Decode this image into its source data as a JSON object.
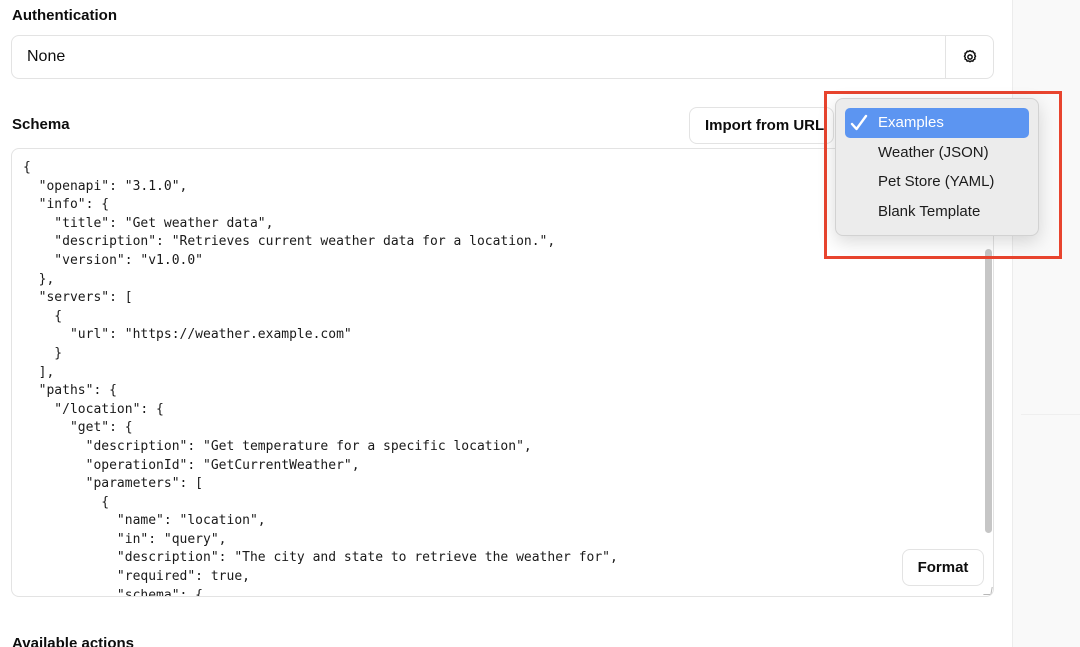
{
  "authentication": {
    "label": "Authentication",
    "value": "None",
    "settings_icon": "gear-icon"
  },
  "schema": {
    "label": "Schema",
    "import_button": "Import from URL",
    "format_button": "Format",
    "code_lines": [
      "{",
      "  \"openapi\": \"3.1.0\",",
      "  \"info\": {",
      "    \"title\": \"Get weather data\",",
      "    \"description\": \"Retrieves current weather data for a location.\",",
      "    \"version\": \"v1.0.0\"",
      "  },",
      "  \"servers\": [",
      "    {",
      "      \"url\": \"https://weather.example.com\"",
      "    }",
      "  ],",
      "  \"paths\": {",
      "    \"/location\": {",
      "      \"get\": {",
      "        \"description\": \"Get temperature for a specific location\",",
      "        \"operationId\": \"GetCurrentWeather\",",
      "        \"parameters\": [",
      "          {",
      "            \"name\": \"location\",",
      "            \"in\": \"query\",",
      "            \"description\": \"The city and state to retrieve the weather for\",",
      "            \"required\": true,",
      "            \"schema\": {"
    ]
  },
  "examples_menu": {
    "selected": "Examples",
    "items": [
      "Examples",
      "Weather (JSON)",
      "Pet Store (YAML)",
      "Blank Template"
    ],
    "selected_color": "#5c95f1"
  },
  "available_actions": {
    "label": "Available actions"
  },
  "colors": {
    "highlight_box": "#e8442e"
  }
}
